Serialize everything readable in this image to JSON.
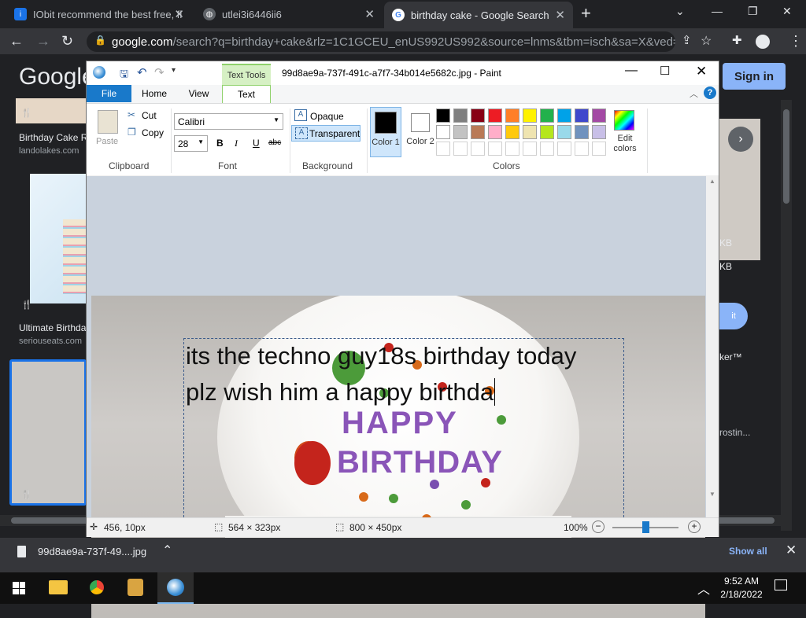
{
  "browser": {
    "tabs": [
      {
        "title": "IObit recommend the best free, fi",
        "active": false
      },
      {
        "title": "utlei3i6446ii6",
        "active": false
      },
      {
        "title": "birthday cake - Google Search",
        "active": true
      }
    ],
    "new_tab": "+",
    "url_host": "google.com",
    "url_path": "/search?q=birthday+cake&rlz=1C1GCEU_enUS992US992&source=lnms&tbm=isch&sa=X&ved=2ah..."
  },
  "google": {
    "logo": "Google",
    "sign_in": "Sign in",
    "results": [
      {
        "title": "Birthday Cake R",
        "source": "landolakes.com"
      },
      {
        "title": "Ultimate Birthda",
        "source": "seriouseats.com"
      }
    ],
    "right_snippets": [
      "KB",
      "KB",
      "it",
      "ker™",
      "rostin..."
    ]
  },
  "paint": {
    "title": "99d8ae9a-737f-491c-a7f7-34b014e5682c.jpg - Paint",
    "context_tab": "Text Tools",
    "tabs": [
      "File",
      "Home",
      "View",
      "Text"
    ],
    "clipboard": {
      "paste": "Paste",
      "cut": "Cut",
      "copy": "Copy",
      "label": "Clipboard"
    },
    "font": {
      "family": "Calibri",
      "size": "28",
      "label": "Font",
      "bold": "B",
      "italic": "I",
      "underline": "U",
      "strike": "abc"
    },
    "background": {
      "opaque": "Opaque",
      "transparent": "Transparent",
      "label": "Background"
    },
    "colors": {
      "color1": "Color 1",
      "color2": "Color 2",
      "edit": "Edit colors",
      "label": "Colors",
      "palette_row1": [
        "#000000",
        "#7f7f7f",
        "#880015",
        "#ed1c24",
        "#ff7f27",
        "#fff200",
        "#22b14c",
        "#00a2e8",
        "#3f48cc",
        "#a349a4"
      ],
      "palette_row2": [
        "#ffffff",
        "#c3c3c3",
        "#b97a57",
        "#ffaec9",
        "#ffc90e",
        "#efe4b0",
        "#b5e61d",
        "#99d9ea",
        "#7092be",
        "#c8bfe7"
      ]
    },
    "text_line1": "its the techno guy18s birthday today",
    "text_line2": "plz wish him a happy birthda",
    "status": {
      "pos": "456, 10px",
      "sel": "564 × 323px",
      "size": "800 × 450px",
      "zoom": "100%"
    }
  },
  "download": {
    "file": "99d8ae9a-737f-49....jpg",
    "show_all": "Show all"
  },
  "taskbar": {
    "time": "9:52 AM",
    "date": "2/18/2022"
  }
}
